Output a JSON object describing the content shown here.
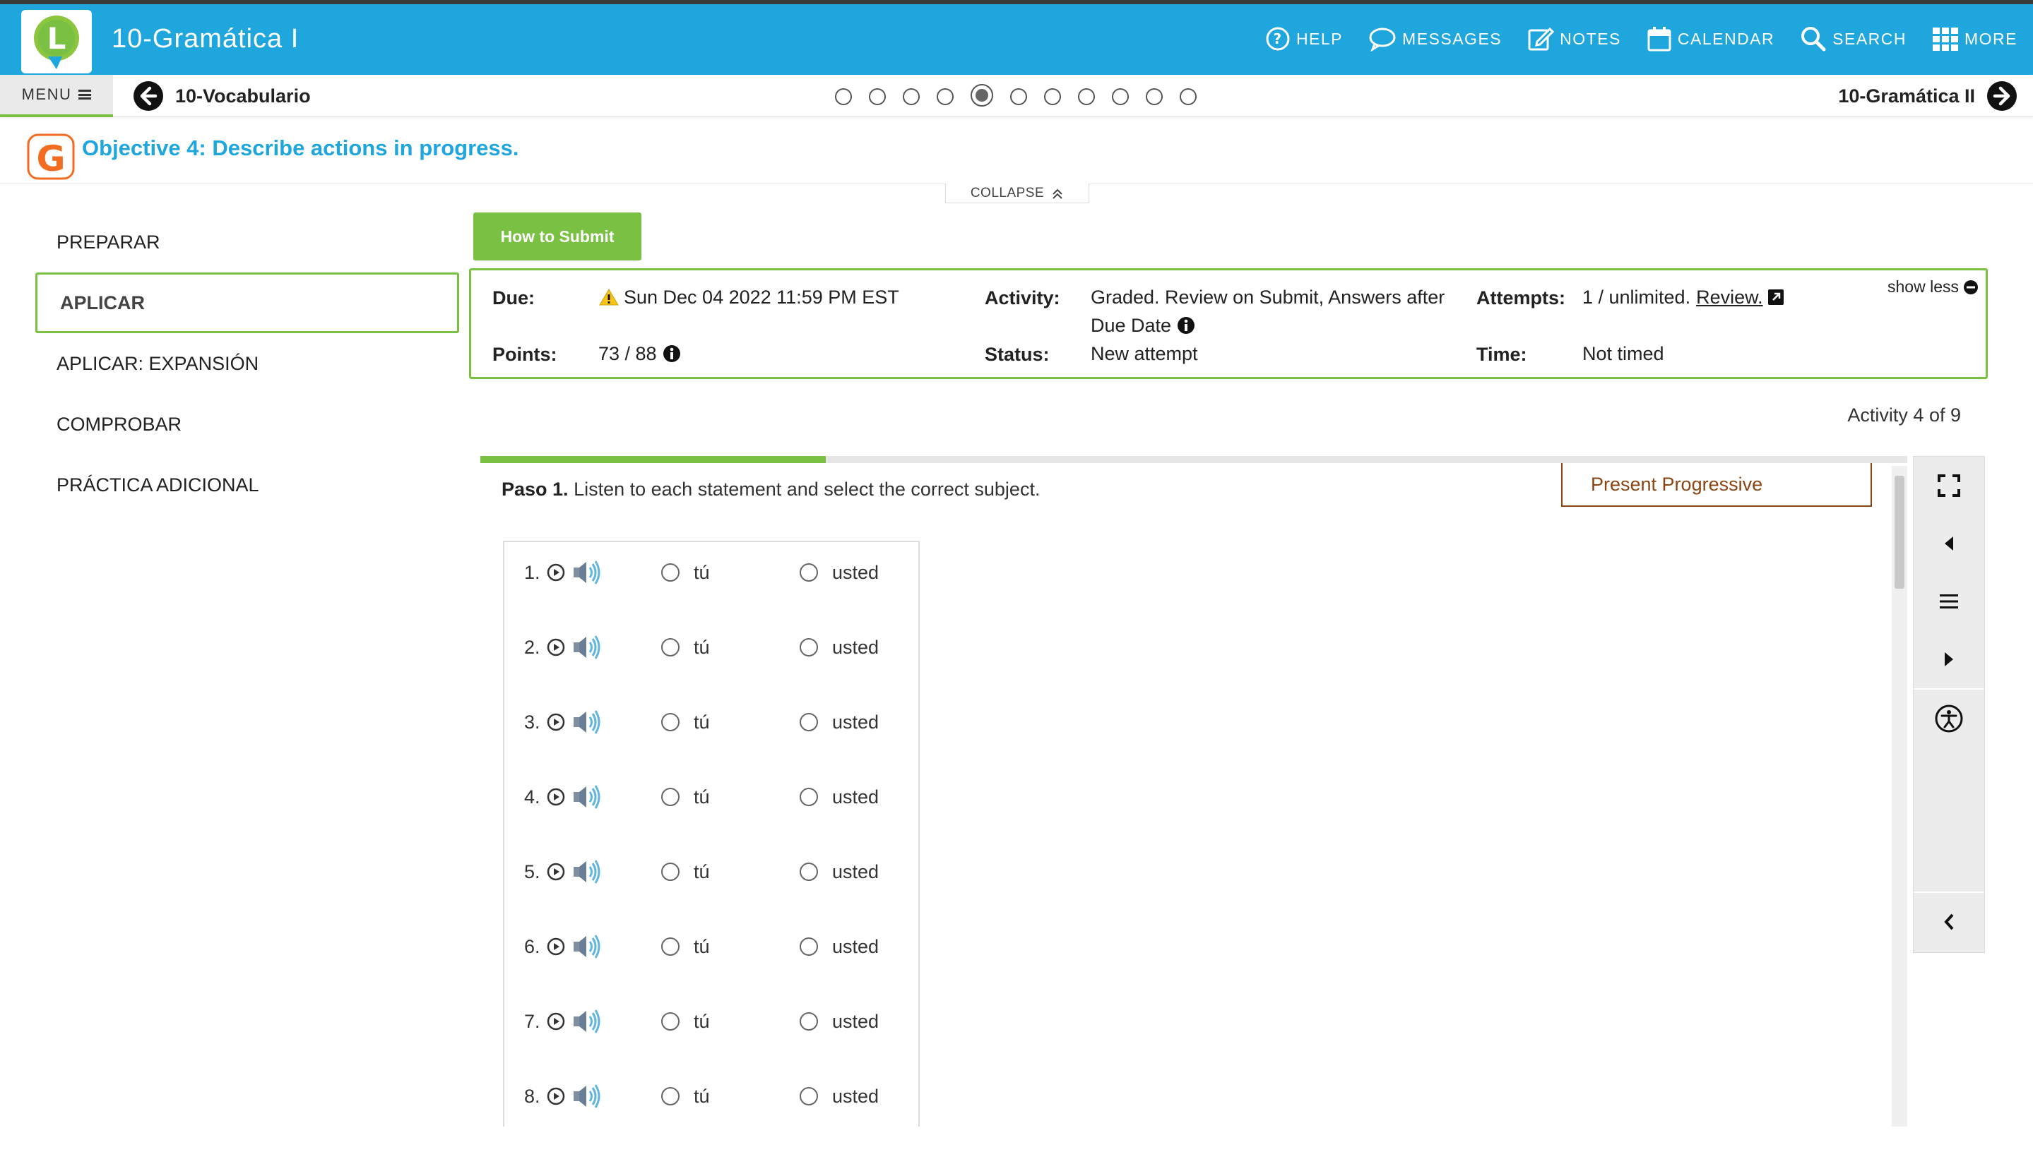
{
  "app": {
    "title": "10-Gramática I",
    "nav": [
      {
        "label": "HELP",
        "icon": "help-icon"
      },
      {
        "label": "MESSAGES",
        "icon": "chat-icon"
      },
      {
        "label": "NOTES",
        "icon": "edit-icon"
      },
      {
        "label": "CALENDAR",
        "icon": "calendar-icon"
      },
      {
        "label": "SEARCH",
        "icon": "search-icon"
      },
      {
        "label": "MORE",
        "icon": "grid-icon"
      }
    ]
  },
  "subnav": {
    "menu_label": "MENU",
    "prev_label": "10-Vocabulario",
    "next_label": "10-Gramática II",
    "dots_total": 11,
    "active_dot": 5
  },
  "objective": {
    "text": "Objective 4: Describe actions in progress.",
    "collapse_label": "COLLAPSE"
  },
  "sidebar": {
    "items": [
      {
        "label": "PREPARAR",
        "active": false
      },
      {
        "label": "APLICAR",
        "active": true
      },
      {
        "label": "APLICAR: EXPANSIÓN",
        "active": false
      },
      {
        "label": "COMPROBAR",
        "active": false
      },
      {
        "label": "PRÁCTICA ADICIONAL",
        "active": false
      }
    ]
  },
  "info": {
    "how_to_submit": "How to Submit",
    "show_less": "show less",
    "due_label": "Due:",
    "due_value": "Sun Dec 04 2022 11:59 PM EST",
    "points_label": "Points:",
    "points_value": "73 / 88",
    "activity_label": "Activity:",
    "activity_value_line1": "Graded. Review on Submit, Answers after",
    "activity_value_line2": "Due Date",
    "status_label": "Status:",
    "status_value": "New attempt",
    "attempts_label": "Attempts:",
    "attempts_value": "1 / unlimited.",
    "review_link": "Review.",
    "time_label": "Time:",
    "time_value": "Not timed"
  },
  "activity": {
    "count_label": "Activity 4 of 9",
    "progress_fraction": 0.242,
    "paso_bold": "Paso 1.",
    "paso_text": "Listen to each statement and select the correct subject.",
    "tag_label": "Present Progressive",
    "options": [
      "tú",
      "usted"
    ],
    "questions": [
      {
        "num": "1."
      },
      {
        "num": "2."
      },
      {
        "num": "3."
      },
      {
        "num": "4."
      },
      {
        "num": "5."
      },
      {
        "num": "6."
      },
      {
        "num": "7."
      },
      {
        "num": "8."
      }
    ]
  },
  "toolbar": {
    "tools": [
      "fullscreen-icon",
      "previous-icon",
      "list-icon",
      "next-icon",
      "accessibility-icon",
      "collapse-panel-icon"
    ]
  },
  "colors": {
    "brand_blue": "#1fa6dd",
    "accent_green": "#7ac143",
    "tag_brown": "#8b4513",
    "objective_orange": "#f26c21"
  }
}
